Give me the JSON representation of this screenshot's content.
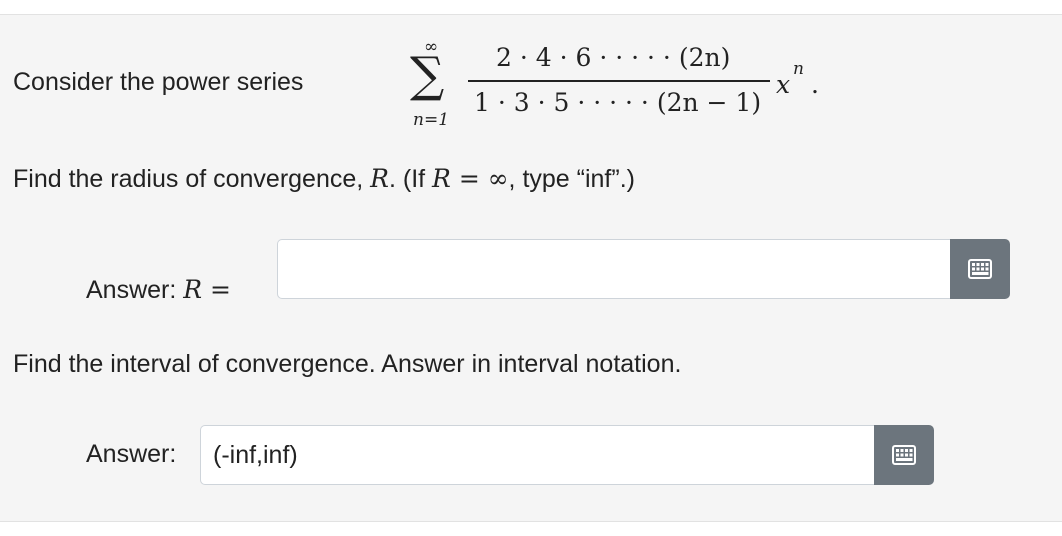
{
  "question": {
    "prompt": "Consider the power series",
    "series": {
      "upper_limit": "∞",
      "lower_limit": "n=1",
      "numerator": "2 · 4 · 6 · · · · · (2n)",
      "denominator": "1 · 3 · 5 · · · · · (2n − 1)",
      "variable": "x",
      "exponent": "n",
      "period": "."
    }
  },
  "part1": {
    "instruction_prefix": "Find the radius of convergence, ",
    "instruction_var": "R",
    "instruction_mid": ". (If ",
    "instruction_eq": "R = ∞",
    "instruction_suffix": ", type “inf”.)",
    "answer_label": "Answer: ",
    "answer_var": "R",
    "answer_eq": " =",
    "input_value": "",
    "keyboard_icon": "keyboard-icon"
  },
  "part2": {
    "instruction": "Find the interval of convergence. Answer in interval notation.",
    "answer_label": "Answer:",
    "input_value": "(-inf,inf)",
    "keyboard_icon": "keyboard-icon"
  },
  "colors": {
    "panel_bg": "#f5f5f5",
    "button_bg": "#6c757d",
    "input_border": "#ced4da"
  }
}
